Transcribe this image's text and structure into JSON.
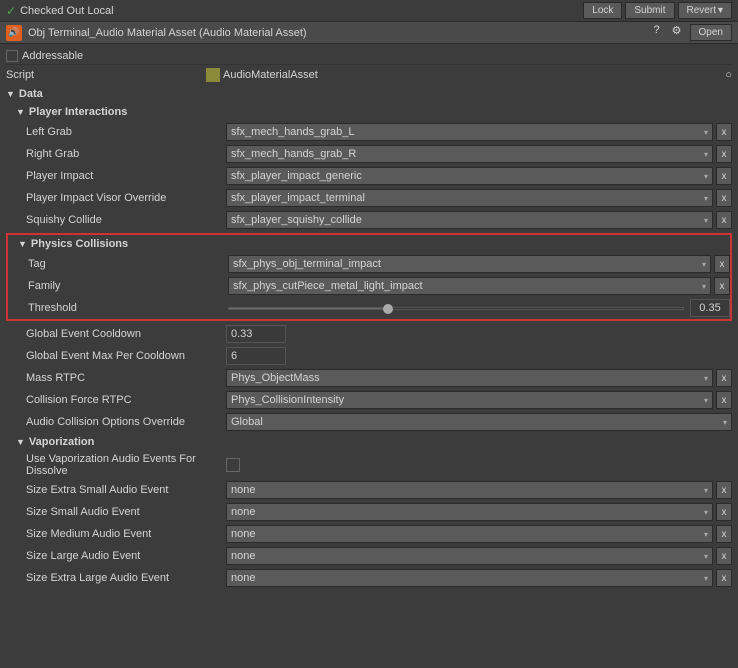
{
  "toolbar": {
    "checked_out_label": "Checked Out Local",
    "lock_btn": "Lock",
    "submit_btn": "Submit",
    "revert_btn": "Revert",
    "revert_arrow": "▾"
  },
  "header": {
    "title": "Obj Terminal_Audio Material Asset (Audio Material Asset)",
    "help_icon": "?",
    "settings_icon": "⚙",
    "open_btn": "Open"
  },
  "addressable": {
    "label": "Addressable"
  },
  "script_row": {
    "label": "Script",
    "value": "AudioMaterialAsset",
    "circle_icon": "○"
  },
  "data_section": {
    "label": "Data",
    "player_interactions": {
      "title": "Player Interactions",
      "left_grab": {
        "label": "Left Grab",
        "value": "sfx_mech_hands_grab_L"
      },
      "right_grab": {
        "label": "Right Grab",
        "value": "sfx_mech_hands_grab_R"
      },
      "player_impact": {
        "label": "Player Impact",
        "value": "sfx_player_impact_generic"
      },
      "player_impact_visor": {
        "label": "Player Impact Visor Override",
        "value": "sfx_player_impact_terminal"
      },
      "squishy_collide": {
        "label": "Squishy Collide",
        "value": "sfx_player_squishy_collide"
      }
    },
    "physics_collisions": {
      "title": "Physics Collisions",
      "tag": {
        "label": "Tag",
        "value": "sfx_phys_obj_terminal_impact"
      },
      "family": {
        "label": "Family",
        "value": "sfx_phys_cutPiece_metal_light_impact"
      },
      "threshold": {
        "label": "Threshold",
        "slider_percent": 35,
        "value": "0.35"
      }
    },
    "global_event_cooldown": {
      "label": "Global Event Cooldown",
      "value": "0.33"
    },
    "global_event_max": {
      "label": "Global Event Max Per Cooldown",
      "value": "6"
    },
    "mass_rtpc": {
      "label": "Mass RTPC",
      "value": "Phys_ObjectMass"
    },
    "collision_force_rtpc": {
      "label": "Collision Force RTPC",
      "value": "Phys_CollisionIntensity"
    },
    "audio_collision_override": {
      "label": "Audio Collision Options Override",
      "value": "Global"
    },
    "vaporization": {
      "title": "Vaporization",
      "use_vaporization": {
        "label": "Use Vaporization Audio Events For Dissolve"
      },
      "size_extra_small": {
        "label": "Size Extra Small Audio Event",
        "value": "none"
      },
      "size_small": {
        "label": "Size Small Audio Event",
        "value": "none"
      },
      "size_medium": {
        "label": "Size Medium Audio Event",
        "value": "none"
      },
      "size_large": {
        "label": "Size Large Audio Event",
        "value": "none"
      },
      "size_extra_large": {
        "label": "Size Extra Large Audio Event",
        "value": "none"
      }
    }
  }
}
